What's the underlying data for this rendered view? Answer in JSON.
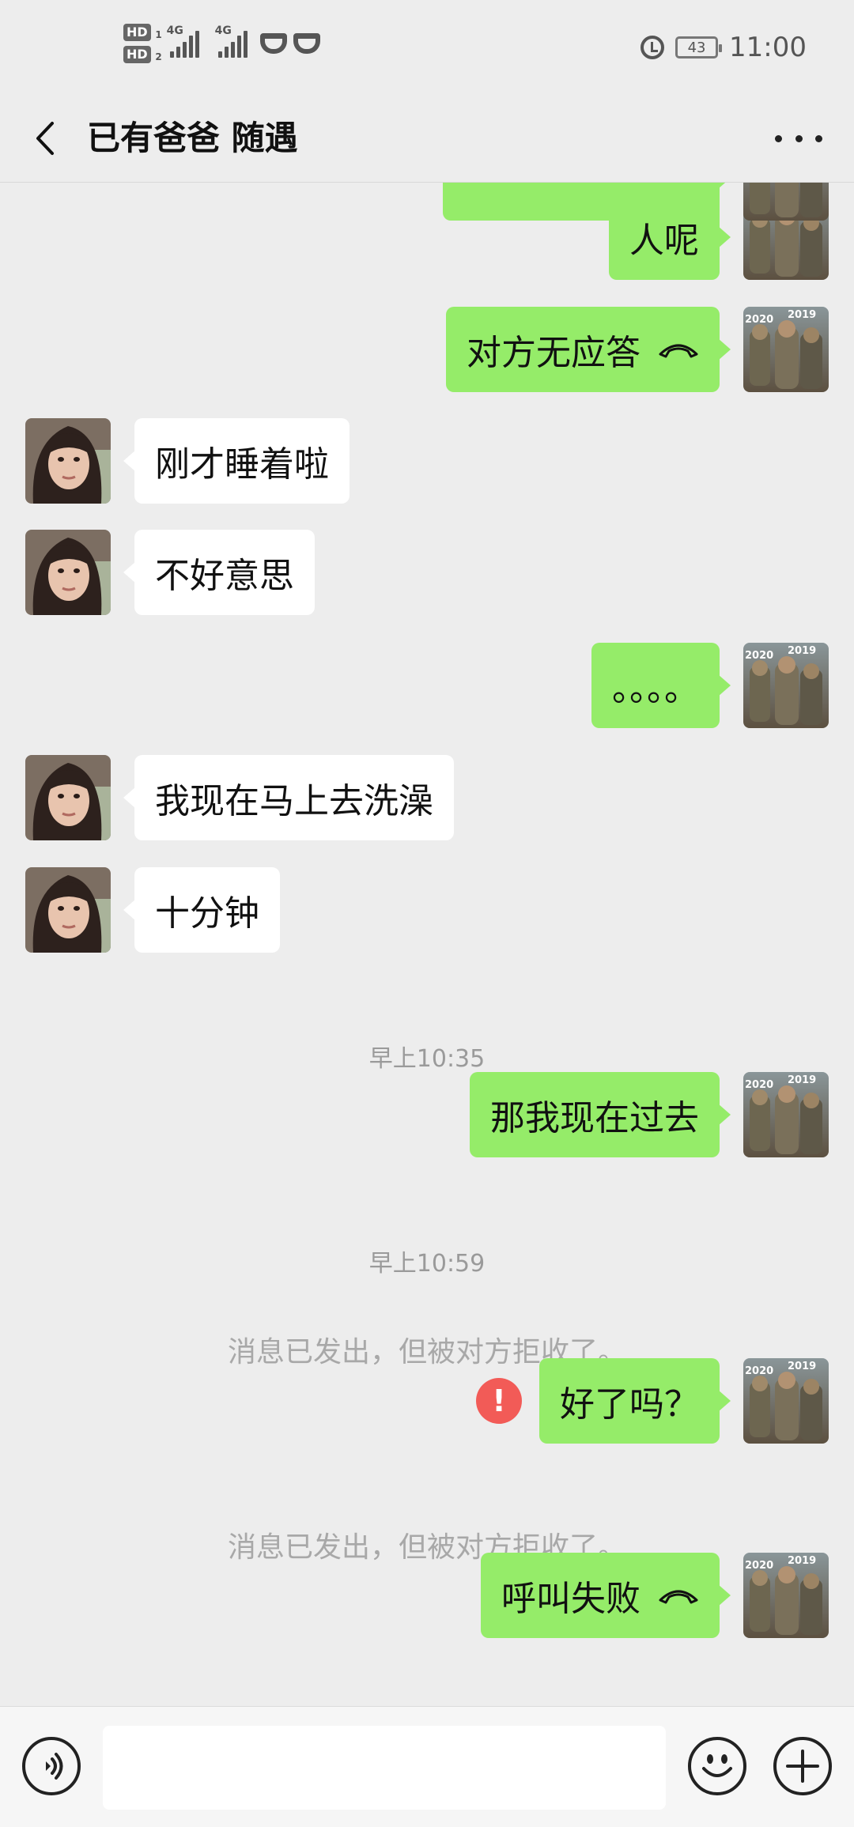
{
  "status_bar": {
    "hd1": "HD",
    "hd1_sub": "1",
    "hd2": "HD",
    "hd2_sub": "2",
    "network1": "4G",
    "network2": "4G",
    "battery": "43",
    "time": "11:00"
  },
  "header": {
    "title": "已有爸爸 随遇"
  },
  "messages": [
    {
      "side": "out",
      "text": "人呢"
    },
    {
      "side": "out",
      "text": "对方无应答",
      "icon": "hangup-phone-icon"
    },
    {
      "side": "in",
      "text": "刚才睡着啦"
    },
    {
      "side": "in",
      "text": "不好意思"
    },
    {
      "side": "out",
      "text": "。。。。"
    },
    {
      "side": "in",
      "text": "我现在马上去洗澡"
    },
    {
      "side": "in",
      "text": "十分钟"
    },
    {
      "type": "timestamp",
      "text": "早上10:35"
    },
    {
      "side": "out",
      "text": "那我现在过去"
    },
    {
      "type": "timestamp",
      "text": "早上10:59"
    },
    {
      "type": "system",
      "text": "消息已发出，但被对方拒收了。"
    },
    {
      "side": "out",
      "text": "好了吗？",
      "status": "failed"
    },
    {
      "type": "system",
      "text": "消息已发出，但被对方拒收了。"
    },
    {
      "side": "out",
      "text": "呼叫失败",
      "icon": "hangup-phone-icon"
    }
  ],
  "avatar_labels": {
    "top": "2019",
    "left": "2020"
  },
  "input": {
    "placeholder": ""
  },
  "colors": {
    "background": "#ededed",
    "outgoing_bubble": "#95ec69",
    "incoming_bubble": "#ffffff",
    "error": "#f25b57"
  }
}
